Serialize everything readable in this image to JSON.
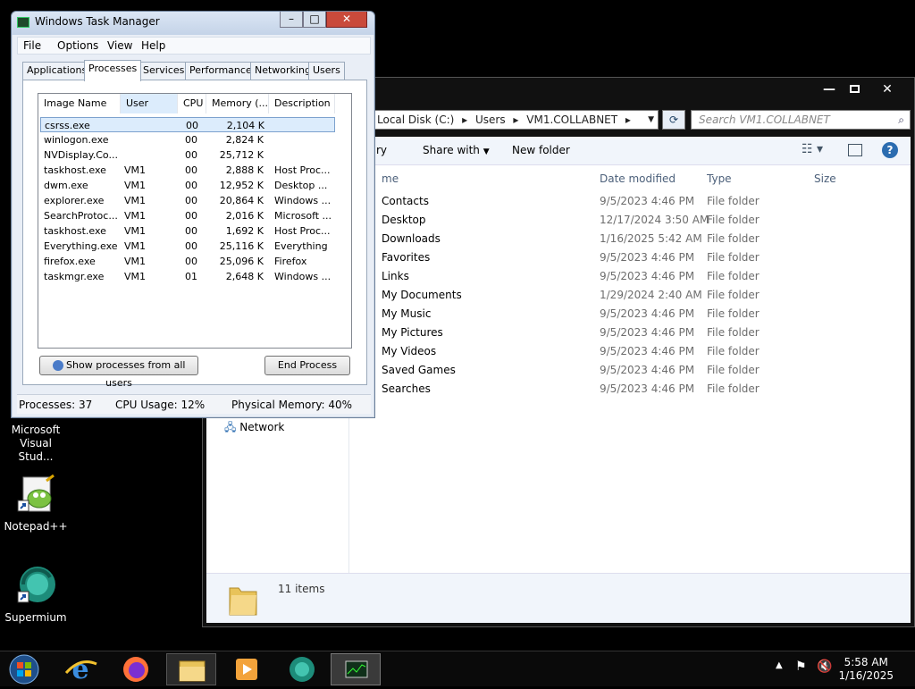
{
  "desktop": {
    "icons": [
      {
        "label": "Microsoft Visual Stud..."
      },
      {
        "label": "Notepad++"
      },
      {
        "label": "Supermium"
      }
    ]
  },
  "explorer": {
    "breadcrumb": [
      "Local Disk (C:)",
      "Users",
      "VM1.COLLABNET"
    ],
    "search_placeholder": "Search VM1.COLLABNET",
    "toolbar": {
      "organize": "ry",
      "share_with": "Share with",
      "new_folder": "New folder"
    },
    "columns": {
      "name": "me",
      "date": "Date modified",
      "type": "Type",
      "size": "Size"
    },
    "files": [
      {
        "name": "Contacts",
        "date": "9/5/2023 4:46 PM",
        "type": "File folder"
      },
      {
        "name": "Desktop",
        "date": "12/17/2024 3:50 AM",
        "type": "File folder"
      },
      {
        "name": "Downloads",
        "date": "1/16/2025 5:42 AM",
        "type": "File folder"
      },
      {
        "name": "Favorites",
        "date": "9/5/2023 4:46 PM",
        "type": "File folder"
      },
      {
        "name": "Links",
        "date": "9/5/2023 4:46 PM",
        "type": "File folder"
      },
      {
        "name": "My Documents",
        "date": "1/29/2024 2:40 AM",
        "type": "File folder"
      },
      {
        "name": "My Music",
        "date": "9/5/2023 4:46 PM",
        "type": "File folder"
      },
      {
        "name": "My Pictures",
        "date": "9/5/2023 4:46 PM",
        "type": "File folder"
      },
      {
        "name": "My Videos",
        "date": "9/5/2023 4:46 PM",
        "type": "File folder"
      },
      {
        "name": "Saved Games",
        "date": "9/5/2023 4:46 PM",
        "type": "File folder"
      },
      {
        "name": "Searches",
        "date": "9/5/2023 4:46 PM",
        "type": "File folder"
      }
    ],
    "nav_network": "Network",
    "status_items": "11 items"
  },
  "taskmgr": {
    "title": "Windows Task Manager",
    "menu": [
      "File",
      "Options",
      "View",
      "Help"
    ],
    "tabs": [
      "Applications",
      "Processes",
      "Services",
      "Performance",
      "Networking",
      "Users"
    ],
    "columns": [
      "Image Name",
      "User Name",
      "CPU",
      "Memory (...",
      "Description"
    ],
    "processes": [
      {
        "name": "csrss.exe",
        "user": "",
        "cpu": "00",
        "mem": "2,104 K",
        "desc": ""
      },
      {
        "name": "winlogon.exe",
        "user": "",
        "cpu": "00",
        "mem": "2,824 K",
        "desc": ""
      },
      {
        "name": "NVDisplay.Co...",
        "user": "",
        "cpu": "00",
        "mem": "25,712 K",
        "desc": ""
      },
      {
        "name": "taskhost.exe",
        "user": "VM1",
        "cpu": "00",
        "mem": "2,888 K",
        "desc": "Host Proc..."
      },
      {
        "name": "dwm.exe",
        "user": "VM1",
        "cpu": "00",
        "mem": "12,952 K",
        "desc": "Desktop ..."
      },
      {
        "name": "explorer.exe",
        "user": "VM1",
        "cpu": "00",
        "mem": "20,864 K",
        "desc": "Windows ..."
      },
      {
        "name": "SearchProtoc...",
        "user": "VM1",
        "cpu": "00",
        "mem": "2,016 K",
        "desc": "Microsoft ..."
      },
      {
        "name": "taskhost.exe",
        "user": "VM1",
        "cpu": "00",
        "mem": "1,692 K",
        "desc": "Host Proc..."
      },
      {
        "name": "Everything.exe",
        "user": "VM1",
        "cpu": "00",
        "mem": "25,116 K",
        "desc": "Everything"
      },
      {
        "name": "firefox.exe",
        "user": "VM1",
        "cpu": "00",
        "mem": "25,096 K",
        "desc": "Firefox"
      },
      {
        "name": "taskmgr.exe",
        "user": "VM1",
        "cpu": "01",
        "mem": "2,648 K",
        "desc": "Windows ..."
      }
    ],
    "show_all_button": "Show processes from all users",
    "end_process_button": "End Process",
    "status": {
      "processes": "Processes: 37",
      "cpu": "CPU Usage: 12%",
      "memory": "Physical Memory: 40%"
    }
  },
  "tray": {
    "time": "5:58 AM",
    "date": "1/16/2025"
  },
  "colors": {
    "selection": "#dcecfc",
    "folder": "#e8c35a",
    "accent": "#2b6cb0"
  }
}
